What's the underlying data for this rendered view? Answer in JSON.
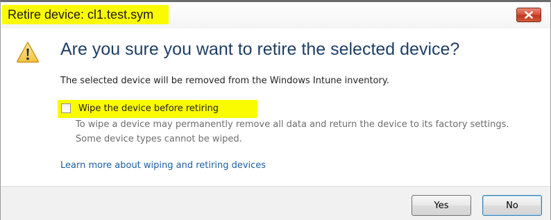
{
  "window": {
    "title": "Retire device: cl1.test.sym",
    "close_icon": "close-icon"
  },
  "dialog": {
    "icon": "warning-icon",
    "heading": "Are you sure you want to retire the selected device?",
    "description": "The selected device will be removed from the Windows Intune inventory.",
    "wipe_checkbox": {
      "label": "Wipe the device before retiring",
      "checked": false,
      "help": "To wipe a device may permanently remove all data and return the device to its factory settings. Some device types cannot be wiped."
    },
    "learn_more_link": "Learn more about wiping and retiring devices"
  },
  "buttons": {
    "yes": "Yes",
    "no": "No"
  },
  "colors": {
    "highlight": "#fbfb00",
    "heading": "#1e3f66",
    "link": "#1a5fa3",
    "close_button": "#c0361f"
  }
}
